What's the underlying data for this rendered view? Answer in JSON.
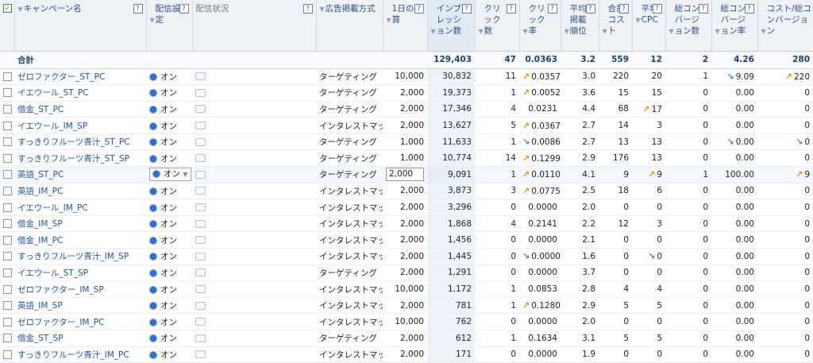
{
  "headers": {
    "campaign": "キャンペーン名",
    "delivery_setting": "配信設定",
    "delivery_status": "配信状況",
    "ad_type": "広告掲載方式",
    "daily_budget": "1日の予算",
    "impressions": "インプレッション数",
    "clicks": "クリック数",
    "ctr": "クリック率",
    "avg_position": "平均掲載順位",
    "total_cost": "合計コスト",
    "avg_cpc": "平均CPC",
    "conversions": "総コンバージョン数",
    "conv_rate": "総コンバージョン率",
    "cost_per_conv": "コスト/総コンバージョン"
  },
  "help_glyph": "?",
  "arrow_glyph": "▼",
  "totals": {
    "label": "合計",
    "impressions": "129,403",
    "clicks": "47",
    "ctr": "0.0363",
    "avg_position": "3.2",
    "total_cost": "559",
    "avg_cpc": "12",
    "conversions": "2",
    "conv_rate": "4.26",
    "cost_per_conv": "280"
  },
  "on_label": "オン",
  "rows": [
    {
      "name": "ゼロファクター_ST_PC",
      "type": "ターゲティング",
      "budget": "10,000",
      "imp": "30,832",
      "clicks": "11",
      "ctr": "0.0357",
      "ctr_t": "up",
      "pos": "3.0",
      "cost": "220",
      "cpc": "20",
      "cpc_t": "",
      "conv": "1",
      "cr": "9.09",
      "cr_t": "dn",
      "cpa": "220",
      "cpa_t": "up"
    },
    {
      "name": "イエウール_ST_PC",
      "type": "ターゲティング",
      "budget": "2,000",
      "imp": "19,373",
      "clicks": "1",
      "ctr": "0.0052",
      "ctr_t": "up",
      "pos": "3.6",
      "cost": "15",
      "cpc": "15",
      "cpc_t": "",
      "conv": "0",
      "cr": "0.00",
      "cr_t": "",
      "cpa": "0",
      "cpa_t": ""
    },
    {
      "name": "借金_ST_PC",
      "type": "ターゲティング",
      "budget": "2,000",
      "imp": "17,346",
      "clicks": "4",
      "ctr": "0.0231",
      "ctr_t": "",
      "pos": "4.4",
      "cost": "68",
      "cpc": "17",
      "cpc_t": "up",
      "conv": "0",
      "cr": "0.00",
      "cr_t": "",
      "cpa": "0",
      "cpa_t": ""
    },
    {
      "name": "イエウール_IM_SP",
      "type": "インタレストマッチ",
      "budget": "2,000",
      "imp": "13,627",
      "clicks": "5",
      "ctr": "0.0367",
      "ctr_t": "up",
      "pos": "2.7",
      "cost": "14",
      "cpc": "3",
      "cpc_t": "",
      "conv": "0",
      "cr": "0.00",
      "cr_t": "",
      "cpa": "0",
      "cpa_t": ""
    },
    {
      "name": "すっきりフルーツ青汁_ST_PC",
      "type": "ターゲティング",
      "budget": "1,000",
      "imp": "11,633",
      "clicks": "1",
      "ctr": "0.0086",
      "ctr_t": "dn",
      "pos": "2.7",
      "cost": "13",
      "cpc": "13",
      "cpc_t": "",
      "conv": "0",
      "cr": "0.00",
      "cr_t": "dn",
      "cpa": "0",
      "cpa_t": "dn"
    },
    {
      "name": "すっきりフルーツ青汁_ST_SP",
      "type": "ターゲティング",
      "budget": "1,000",
      "imp": "10,774",
      "clicks": "14",
      "ctr": "0.1299",
      "ctr_t": "up",
      "pos": "2.9",
      "cost": "176",
      "cpc": "13",
      "cpc_t": "",
      "conv": "0",
      "cr": "0.00",
      "cr_t": "",
      "cpa": "0",
      "cpa_t": ""
    },
    {
      "name": "英語_ST_PC",
      "type": "ターゲティング",
      "budget": "2,000",
      "imp": "9,091",
      "clicks": "1",
      "ctr": "0.0110",
      "ctr_t": "up",
      "pos": "4.1",
      "cost": "9",
      "cpc": "9",
      "cpc_t": "up",
      "conv": "1",
      "cr": "100.00",
      "cr_t": "",
      "cpa": "9",
      "cpa_t": "up",
      "hl": true
    },
    {
      "name": "英語_IM_PC",
      "type": "インタレストマッチ",
      "budget": "2,000",
      "imp": "3,873",
      "clicks": "3",
      "ctr": "0.0775",
      "ctr_t": "up",
      "pos": "2.5",
      "cost": "18",
      "cpc": "6",
      "cpc_t": "",
      "conv": "0",
      "cr": "0.00",
      "cr_t": "",
      "cpa": "0",
      "cpa_t": ""
    },
    {
      "name": "イエウール_IM_PC",
      "type": "インタレストマッチ",
      "budget": "2,000",
      "imp": "3,296",
      "clicks": "0",
      "ctr": "0.0000",
      "ctr_t": "",
      "pos": "2.0",
      "cost": "0",
      "cpc": "0",
      "cpc_t": "",
      "conv": "0",
      "cr": "0.00",
      "cr_t": "",
      "cpa": "0",
      "cpa_t": ""
    },
    {
      "name": "借金_IM_SP",
      "type": "インタレストマッチ",
      "budget": "2,000",
      "imp": "1,868",
      "clicks": "4",
      "ctr": "0.2141",
      "ctr_t": "",
      "pos": "2.2",
      "cost": "12",
      "cpc": "3",
      "cpc_t": "",
      "conv": "0",
      "cr": "0.00",
      "cr_t": "",
      "cpa": "0",
      "cpa_t": ""
    },
    {
      "name": "借金_IM_PC",
      "type": "インタレストマッチ",
      "budget": "2,000",
      "imp": "1,456",
      "clicks": "0",
      "ctr": "0.0000",
      "ctr_t": "",
      "pos": "2.1",
      "cost": "0",
      "cpc": "0",
      "cpc_t": "",
      "conv": "0",
      "cr": "0.00",
      "cr_t": "",
      "cpa": "0",
      "cpa_t": ""
    },
    {
      "name": "すっきりフルーツ青汁_IM_SP",
      "type": "インタレストマッチ",
      "budget": "2,000",
      "imp": "1,445",
      "clicks": "0",
      "ctr": "0.0000",
      "ctr_t": "dn",
      "pos": "1.6",
      "cost": "0",
      "cpc": "0",
      "cpc_t": "dn",
      "conv": "0",
      "cr": "0.00",
      "cr_t": "",
      "cpa": "0",
      "cpa_t": ""
    },
    {
      "name": "イエウール_ST_SP",
      "type": "ターゲティング",
      "budget": "2,000",
      "imp": "1,291",
      "clicks": "0",
      "ctr": "0.0000",
      "ctr_t": "",
      "pos": "3.7",
      "cost": "0",
      "cpc": "0",
      "cpc_t": "",
      "conv": "0",
      "cr": "0.00",
      "cr_t": "",
      "cpa": "0",
      "cpa_t": ""
    },
    {
      "name": "ゼロファクター_IM_SP",
      "type": "インタレストマッチ",
      "budget": "10,000",
      "imp": "1,172",
      "clicks": "1",
      "ctr": "0.0853",
      "ctr_t": "",
      "pos": "2.8",
      "cost": "4",
      "cpc": "4",
      "cpc_t": "",
      "conv": "0",
      "cr": "0.00",
      "cr_t": "",
      "cpa": "0",
      "cpa_t": ""
    },
    {
      "name": "英語_IM_SP",
      "type": "インタレストマッチ",
      "budget": "2,000",
      "imp": "781",
      "clicks": "1",
      "ctr": "0.1280",
      "ctr_t": "up",
      "pos": "2.9",
      "cost": "5",
      "cpc": "5",
      "cpc_t": "",
      "conv": "0",
      "cr": "0.00",
      "cr_t": "",
      "cpa": "0",
      "cpa_t": ""
    },
    {
      "name": "ゼロファクター_IM_PC",
      "type": "インタレストマッチ",
      "budget": "10,000",
      "imp": "762",
      "clicks": "0",
      "ctr": "0.0000",
      "ctr_t": "",
      "pos": "2.0",
      "cost": "0",
      "cpc": "0",
      "cpc_t": "",
      "conv": "0",
      "cr": "0.00",
      "cr_t": "",
      "cpa": "0",
      "cpa_t": ""
    },
    {
      "name": "借金_ST_SP",
      "type": "ターゲティング",
      "budget": "2,000",
      "imp": "612",
      "clicks": "1",
      "ctr": "0.1634",
      "ctr_t": "",
      "pos": "3.1",
      "cost": "5",
      "cpc": "5",
      "cpc_t": "",
      "conv": "0",
      "cr": "0.00",
      "cr_t": "",
      "cpa": "0",
      "cpa_t": ""
    },
    {
      "name": "すっきりフルーツ青汁_IM_PC",
      "type": "インタレストマッチ",
      "budget": "2,000",
      "imp": "171",
      "clicks": "0",
      "ctr": "0.0000",
      "ctr_t": "",
      "pos": "1.9",
      "cost": "0",
      "cpc": "0",
      "cpc_t": "",
      "conv": "0",
      "cr": "0.00",
      "cr_t": "",
      "cpa": "0",
      "cpa_t": ""
    }
  ]
}
